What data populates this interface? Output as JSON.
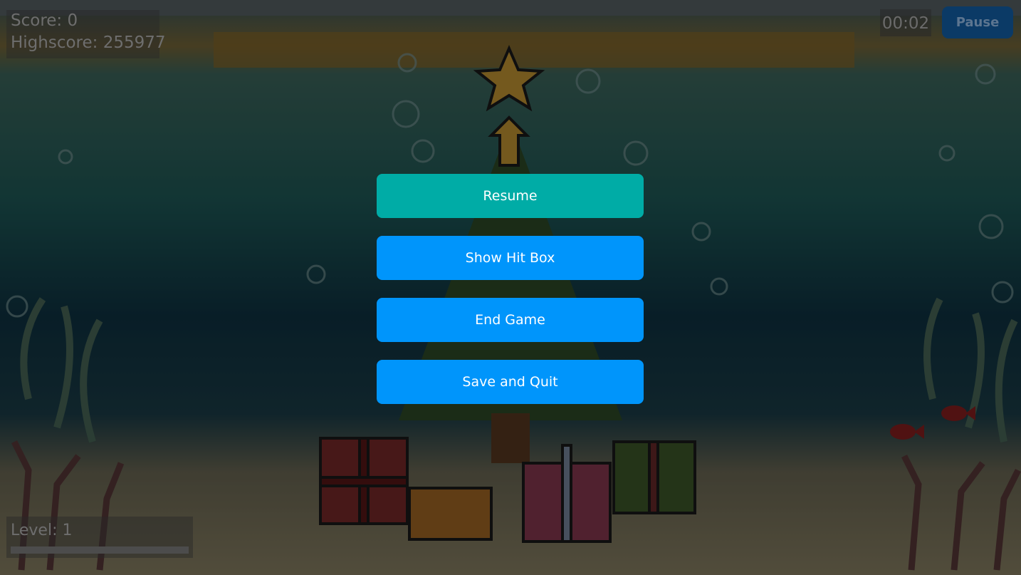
{
  "hud": {
    "score_label": "Score: 0",
    "highscore_label": "Highscore: 255977",
    "timer": "00:02",
    "pause_label": "Pause",
    "level_label": "Level: 1",
    "level_progress": 0
  },
  "menu": {
    "resume_label": "Resume",
    "hitbox_label": "Show Hit Box",
    "end_label": "End Game",
    "save_quit_label": "Save and Quit"
  },
  "colors": {
    "resume_button": "#00aca6",
    "menu_button": "#0095fb",
    "pause_button": "#0b3a66"
  }
}
